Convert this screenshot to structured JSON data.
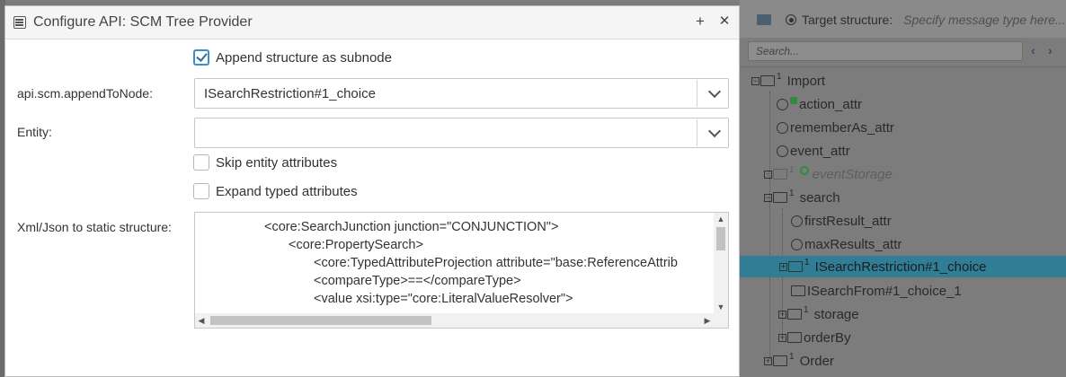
{
  "dialog": {
    "title": "Configure API: SCM Tree Provider",
    "maximize_icon": "+",
    "close_icon": "✕",
    "append_label": "Append structure as subnode",
    "append_checked": true,
    "append_to_node_label": "api.scm.appendToNode:",
    "append_to_node_value": "ISearchRestriction#1_choice",
    "entity_label": "Entity:",
    "entity_value": "",
    "skip_entity_label": "Skip entity attributes",
    "expand_typed_label": "Expand typed attributes",
    "xml_label": "Xml/Json to static structure:",
    "xml_lines": [
      "<core:SearchJunction junction=\"CONJUNCTION\">",
      "<core:PropertySearch>",
      "<core:TypedAttributeProjection attribute=\"base:ReferenceAttrib",
      "<compareType>==</compareType>",
      "<value xsi:type=\"core:LiteralValueResolver\">"
    ]
  },
  "background": {
    "target_label": "Target structure:",
    "target_placeholder": "Specify message type here...",
    "search_placeholder": "Search...",
    "nav_prev": "‹",
    "nav_next": "›",
    "tree": [
      {
        "label": "Import",
        "sup": "1"
      },
      {
        "label": "action_attr"
      },
      {
        "label": "rememberAs_attr"
      },
      {
        "label": "event_attr"
      },
      {
        "label": "eventStorage",
        "sup": "1"
      },
      {
        "label": "search",
        "sup": "1"
      },
      {
        "label": "firstResult_attr"
      },
      {
        "label": "maxResults_attr"
      },
      {
        "label": "ISearchRestriction#1_choice",
        "sup": "1"
      },
      {
        "label": "ISearchFrom#1_choice_1"
      },
      {
        "label": "storage",
        "sup": "1"
      },
      {
        "label": "orderBy"
      },
      {
        "label": "Order",
        "sup": "1"
      }
    ],
    "selected_color": "#2f7e96"
  }
}
